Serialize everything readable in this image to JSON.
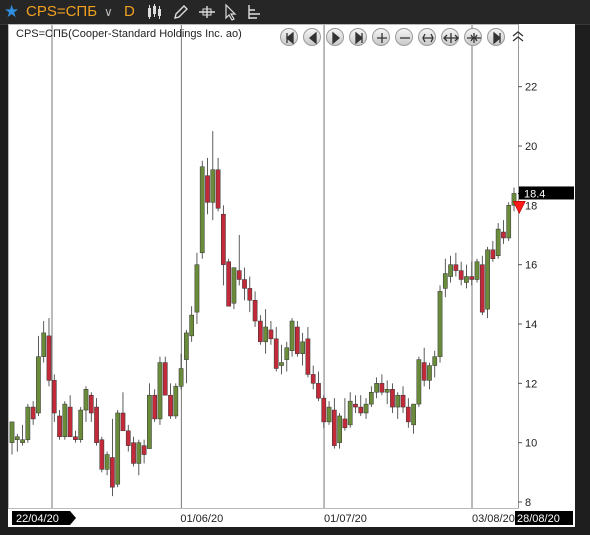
{
  "toolbar": {
    "symbol": "CPS=СПБ",
    "period": "D",
    "icons": [
      "star-icon",
      "chevron-down-icon",
      "candlestick-icon",
      "pencil-icon",
      "crosshair-icon",
      "cursor-icon",
      "indicator-icon"
    ]
  },
  "chart": {
    "subtitle": "CPS=СПБ(Cooper-Standard Holdings Inc. ao)",
    "last_price_label": "18.4",
    "nav_buttons": [
      "first",
      "prev",
      "play",
      "next",
      "zoom-in",
      "zoom-out",
      "zoom-fit",
      "expand",
      "compress",
      "last",
      "collapse"
    ],
    "colors": {
      "up": "#6a8c3a",
      "down": "#c22a3a",
      "marker": "#ff1a1a"
    }
  },
  "chart_data": {
    "type": "candlestick",
    "title": "CPS=СПБ(Cooper-Standard Holdings Inc. ao)",
    "xlabel": "",
    "ylabel": "",
    "ylim": [
      8,
      23
    ],
    "yticks": [
      8,
      10,
      12,
      14,
      16,
      18,
      20,
      22
    ],
    "xtick_labels": [
      "22/04/20",
      "01/06/20",
      "01/07/20",
      "03/08/20",
      "28/08/20"
    ],
    "last_price": 18.4,
    "candles": [
      [
        10.0,
        10.7,
        9.6,
        10.7
      ],
      [
        10.1,
        10.3,
        9.7,
        10.2
      ],
      [
        10.0,
        10.6,
        9.9,
        10.1
      ],
      [
        10.1,
        11.3,
        10.0,
        11.2
      ],
      [
        11.2,
        11.4,
        10.6,
        10.8
      ],
      [
        11.0,
        13.6,
        10.9,
        12.9
      ],
      [
        12.9,
        14.1,
        12.7,
        13.7
      ],
      [
        13.6,
        14.2,
        11.9,
        12.1
      ],
      [
        12.1,
        12.3,
        10.7,
        11.0
      ],
      [
        10.9,
        11.1,
        10.1,
        10.2
      ],
      [
        10.2,
        11.4,
        10.1,
        11.3
      ],
      [
        11.2,
        11.6,
        10.2,
        10.2
      ],
      [
        10.2,
        10.4,
        10.0,
        10.1
      ],
      [
        10.1,
        11.2,
        10.0,
        11.1
      ],
      [
        11.1,
        11.9,
        10.7,
        11.8
      ],
      [
        11.6,
        11.7,
        10.7,
        11.0
      ],
      [
        11.2,
        11.5,
        9.9,
        10.0
      ],
      [
        10.1,
        10.2,
        9.0,
        9.1
      ],
      [
        9.1,
        9.7,
        8.9,
        9.6
      ],
      [
        9.5,
        10.8,
        8.2,
        8.5
      ],
      [
        8.6,
        11.1,
        8.5,
        11.0
      ],
      [
        11.0,
        11.7,
        10.4,
        10.4
      ],
      [
        10.4,
        10.6,
        9.7,
        9.9
      ],
      [
        10.0,
        10.2,
        9.2,
        9.3
      ],
      [
        9.3,
        10.1,
        8.9,
        10.0
      ],
      [
        9.9,
        10.1,
        9.3,
        9.6
      ],
      [
        9.8,
        12.0,
        9.8,
        11.6
      ],
      [
        11.6,
        11.8,
        10.7,
        10.8
      ],
      [
        10.8,
        12.9,
        10.6,
        12.7
      ],
      [
        12.7,
        12.9,
        11.6,
        11.6
      ],
      [
        11.6,
        12.0,
        10.8,
        10.9
      ],
      [
        10.9,
        12.0,
        10.8,
        11.9
      ],
      [
        11.9,
        13.0,
        11.8,
        12.5
      ],
      [
        12.8,
        13.8,
        12.0,
        13.7
      ],
      [
        13.6,
        14.6,
        13.4,
        14.3
      ],
      [
        14.4,
        16.4,
        14.0,
        16.0
      ],
      [
        16.4,
        19.5,
        16.2,
        19.3
      ],
      [
        19.0,
        19.6,
        17.7,
        18.1
      ],
      [
        18.1,
        20.5,
        17.5,
        19.2
      ],
      [
        19.2,
        19.6,
        17.8,
        17.9
      ],
      [
        17.7,
        18.0,
        15.3,
        16.0
      ],
      [
        16.1,
        16.2,
        14.6,
        14.6
      ],
      [
        14.7,
        15.9,
        14.5,
        15.9
      ],
      [
        15.8,
        17.0,
        15.3,
        15.5
      ],
      [
        15.5,
        15.9,
        14.8,
        15.2
      ],
      [
        15.2,
        15.6,
        14.4,
        14.8
      ],
      [
        14.8,
        15.1,
        13.9,
        14.1
      ],
      [
        14.1,
        14.3,
        13.3,
        13.4
      ],
      [
        13.4,
        14.5,
        13.0,
        13.9
      ],
      [
        13.8,
        14.1,
        13.3,
        13.5
      ],
      [
        13.5,
        13.9,
        12.4,
        12.5
      ],
      [
        12.6,
        13.3,
        12.3,
        12.7
      ],
      [
        12.8,
        13.4,
        12.4,
        13.2
      ],
      [
        13.1,
        14.2,
        12.9,
        14.1
      ],
      [
        13.9,
        14.1,
        12.9,
        13.0
      ],
      [
        13.0,
        13.7,
        12.6,
        13.4
      ],
      [
        13.5,
        13.9,
        12.2,
        12.3
      ],
      [
        12.3,
        12.6,
        11.8,
        12.0
      ],
      [
        12.0,
        12.4,
        11.4,
        11.5
      ],
      [
        11.5,
        11.6,
        10.5,
        10.7
      ],
      [
        10.7,
        11.4,
        10.6,
        11.2
      ],
      [
        11.1,
        11.5,
        9.8,
        9.9
      ],
      [
        10.0,
        11.0,
        9.8,
        10.9
      ],
      [
        10.8,
        11.5,
        10.4,
        10.5
      ],
      [
        10.6,
        11.7,
        10.5,
        11.4
      ],
      [
        11.3,
        11.6,
        11.0,
        11.2
      ],
      [
        11.2,
        11.6,
        10.9,
        11.0
      ],
      [
        11.0,
        11.5,
        10.8,
        11.3
      ],
      [
        11.3,
        11.9,
        11.2,
        11.7
      ],
      [
        11.7,
        12.2,
        11.5,
        12.0
      ],
      [
        12.0,
        12.3,
        11.6,
        11.7
      ],
      [
        11.7,
        12.1,
        11.3,
        11.8
      ],
      [
        11.8,
        12.0,
        11.0,
        11.2
      ],
      [
        11.2,
        11.7,
        10.8,
        11.6
      ],
      [
        11.6,
        11.9,
        11.0,
        11.2
      ],
      [
        11.2,
        11.5,
        10.5,
        10.7
      ],
      [
        10.6,
        11.3,
        10.3,
        11.3
      ],
      [
        11.3,
        12.9,
        11.2,
        12.8
      ],
      [
        12.7,
        13.2,
        11.9,
        12.1
      ],
      [
        12.1,
        12.7,
        11.8,
        12.6
      ],
      [
        12.6,
        13.1,
        12.2,
        12.9
      ],
      [
        12.9,
        15.3,
        12.7,
        15.1
      ],
      [
        15.2,
        16.2,
        14.9,
        15.7
      ],
      [
        15.6,
        16.3,
        15.4,
        16.0
      ],
      [
        16.0,
        16.4,
        15.6,
        15.8
      ],
      [
        15.8,
        16.1,
        15.3,
        15.5
      ],
      [
        15.4,
        16.0,
        15.2,
        15.6
      ],
      [
        15.6,
        16.1,
        15.3,
        15.5
      ],
      [
        15.5,
        16.2,
        15.4,
        16.1
      ],
      [
        16.0,
        16.3,
        14.3,
        14.4
      ],
      [
        14.5,
        16.6,
        14.2,
        16.5
      ],
      [
        16.5,
        16.8,
        16.1,
        16.2
      ],
      [
        16.3,
        17.4,
        16.2,
        17.2
      ],
      [
        17.1,
        17.5,
        16.7,
        16.9
      ],
      [
        16.9,
        18.1,
        16.8,
        18.0
      ],
      [
        18.0,
        18.6,
        17.8,
        18.4
      ]
    ],
    "marker": {
      "type": "sell-arrow",
      "at_candle": 96,
      "value": 17.9
    }
  }
}
